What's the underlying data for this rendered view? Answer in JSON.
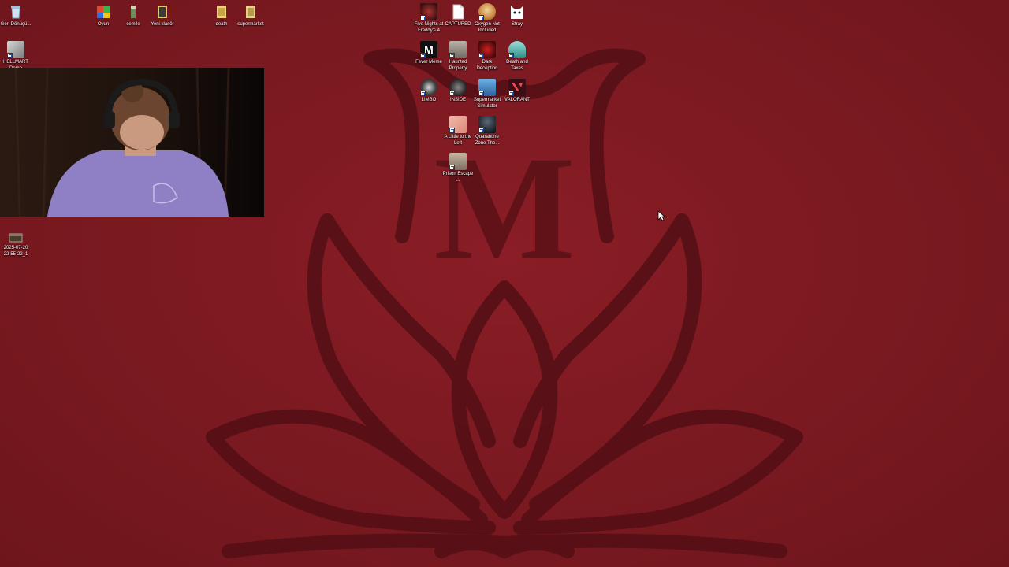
{
  "desktop": {
    "background_color": "#7d1a22",
    "wallpaper_letter": "M",
    "icons_left": [
      {
        "label": "Geri Dönüşü...",
        "icon": "recycle-bin-icon"
      },
      {
        "label": "HELLMART Demo",
        "icon": "hellmart-icon"
      },
      {
        "label": "2025-07-20 22-55-22_1",
        "icon": "video-file-icon"
      }
    ],
    "icons_top": [
      {
        "label": "Oyun",
        "icon": "folder-icon"
      },
      {
        "label": "cemile",
        "icon": "file-icon"
      },
      {
        "label": "Yeni klasör",
        "icon": "folder-icon"
      },
      {
        "label": "death",
        "icon": "folder-icon"
      },
      {
        "label": "supermarket",
        "icon": "folder-icon"
      }
    ],
    "game_icons": [
      {
        "label": "Five Nights at Freddy's 4",
        "icon": "fnaf4-icon"
      },
      {
        "label": "CAPTURED",
        "icon": "captured-icon"
      },
      {
        "label": "Oxygen Not Included",
        "icon": "oxygen-not-included-icon"
      },
      {
        "label": "Stray",
        "icon": "stray-icon"
      },
      {
        "label": "Fever Meme",
        "icon": "fever-meme-icon"
      },
      {
        "label": "Haunted Property",
        "icon": "haunted-property-icon"
      },
      {
        "label": "Dark Deception",
        "icon": "dark-deception-icon"
      },
      {
        "label": "Death and Taxes",
        "icon": "death-and-taxes-icon"
      },
      {
        "label": "LIMBO",
        "icon": "limbo-icon"
      },
      {
        "label": "INSIDE",
        "icon": "inside-icon"
      },
      {
        "label": "Supermarket Simulator",
        "icon": "supermarket-simulator-icon"
      },
      {
        "label": "VALORANT",
        "icon": "valorant-icon"
      },
      {
        "label": "A Little to the Left",
        "icon": "a-little-to-the-left-icon"
      },
      {
        "label": "Quarantine Zone The...",
        "icon": "quarantine-zone-icon"
      },
      {
        "label": "Prison Escape ...",
        "icon": "prison-escape-icon"
      }
    ]
  },
  "webcam": {
    "shirt_color": "#8e7fc4",
    "hair_color": "#5a3a25",
    "headphones_color": "#1b1b1b"
  },
  "cursor": {
    "icon": "mouse-pointer-icon"
  }
}
